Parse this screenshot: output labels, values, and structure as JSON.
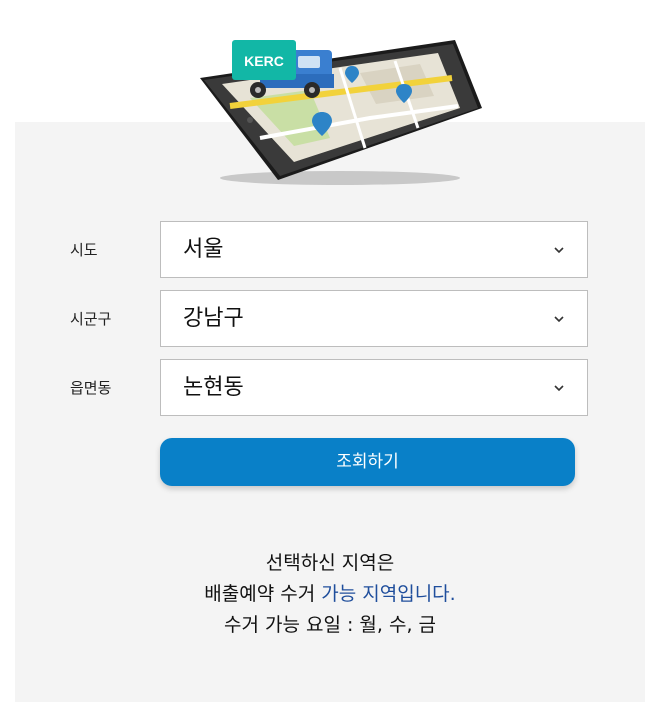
{
  "hero": {
    "truck_label": "KERC"
  },
  "form": {
    "sido": {
      "label": "시도",
      "value": "서울"
    },
    "sigungu": {
      "label": "시군구",
      "value": "강남구"
    },
    "eupmyeondong": {
      "label": "읍면동",
      "value": "논현동"
    },
    "submit_label": "조회하기"
  },
  "result": {
    "line1": "선택하신 지역은",
    "line2_prefix": "배출예약 수거 ",
    "line2_highlight": "가능 지역입니다.",
    "line3": "수거 가능 요일 : 월, 수, 금"
  },
  "colors": {
    "button": "#0980c8",
    "highlight": "#1f4e9c",
    "truck_brand": "#12b7a6"
  }
}
